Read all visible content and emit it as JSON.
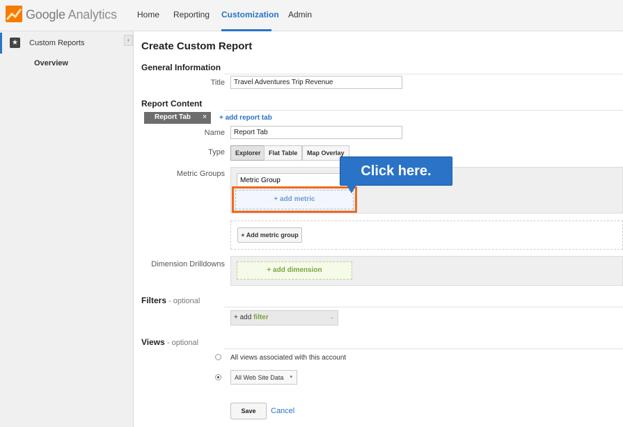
{
  "header": {
    "brand_google": "Google",
    "brand_analytics": "Analytics",
    "nav": [
      {
        "label": "Home"
      },
      {
        "label": "Reporting"
      },
      {
        "label": "Customization",
        "active": true
      },
      {
        "label": "Admin"
      }
    ],
    "accent_color": "#2a73c6"
  },
  "sidebar": {
    "item_label": "Custom Reports",
    "item_icon": "star-icon",
    "sub_item_label": "Overview",
    "collapse_glyph": "‹"
  },
  "main": {
    "page_title": "Create Custom Report",
    "general": {
      "heading": "General Information",
      "title_label": "Title",
      "title_value": "Travel Adventures Trip Revenue"
    },
    "content": {
      "heading": "Report Content",
      "tab_label": "Report Tab",
      "tab_close": "×",
      "add_tab_link": "+ add report tab",
      "name_label": "Name",
      "name_value": "Report Tab",
      "type_label": "Type",
      "types": [
        "Explorer",
        "Flat Table",
        "Map Overlay"
      ],
      "metric_groups_label": "Metric Groups",
      "metric_group_name": "Metric Group",
      "add_metric": "+ add metric",
      "add_metric_group": "+ Add metric group",
      "dimension_label": "Dimension Drilldowns",
      "add_dimension": "+ add dimension"
    },
    "filters": {
      "heading": "Filters",
      "optional": " - optional",
      "add_prefix": "+ add",
      "add_word": "filter",
      "caret": "⌄"
    },
    "views": {
      "heading": "Views",
      "optional": " - optional",
      "option_all": "All views associated with this account",
      "selected_view": "All Web Site Data",
      "caret": "▾"
    },
    "save_label": "Save",
    "cancel_label": "Cancel"
  },
  "callout": {
    "text": "Click here.",
    "highlight_color": "#f06a1a"
  }
}
